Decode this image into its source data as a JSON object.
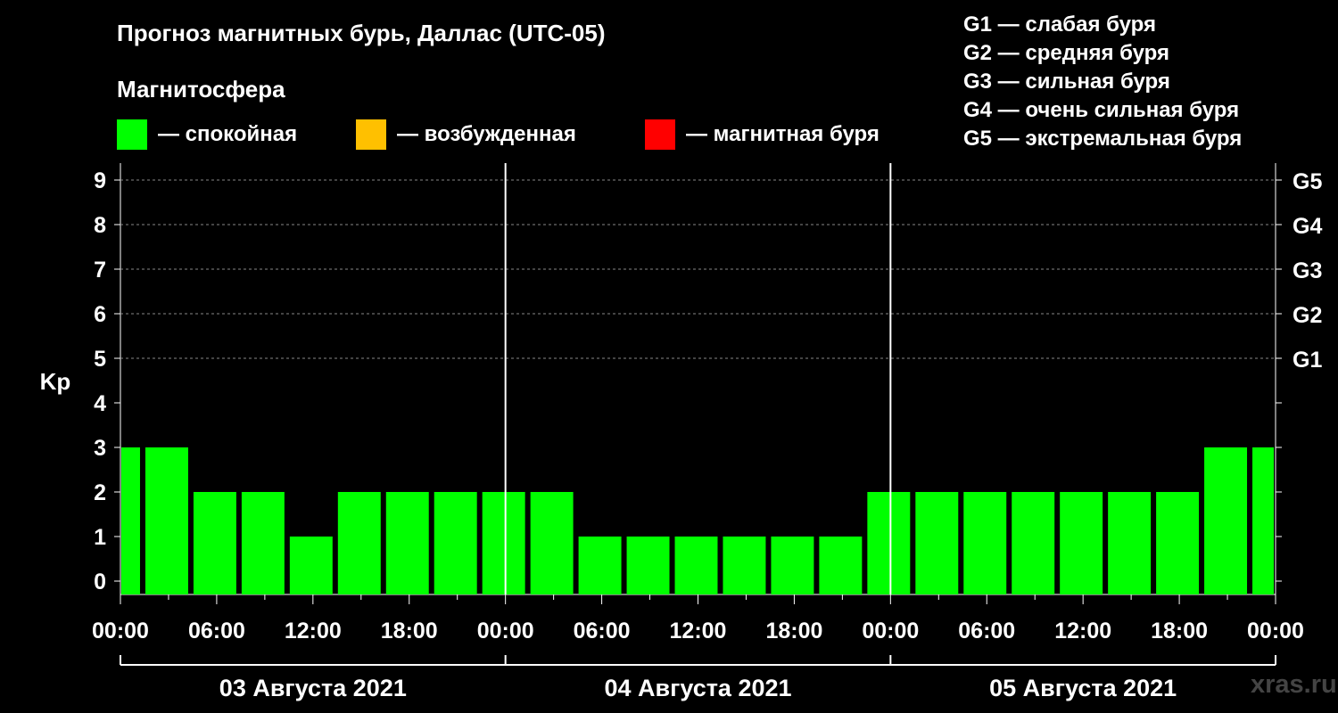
{
  "header": {
    "title": "Прогноз магнитных бурь, Даллас (UTC-05)",
    "magnetosphere_label": "Магнитосфера"
  },
  "legend": [
    {
      "label": "— спокойная",
      "color": "#00ff00"
    },
    {
      "label": "— возбужденная",
      "color": "#ffc000"
    },
    {
      "label": "— магнитная буря",
      "color": "#ff0000"
    }
  ],
  "g_legend": [
    "G1 — слабая буря",
    "G2 — средняя буря",
    "G3 — сильная буря",
    "G4 — очень сильная буря",
    "G5 — экстремальная буря"
  ],
  "watermark": "xras.ru",
  "chart_data": {
    "type": "bar",
    "ylabel": "Kp",
    "ylim": [
      0,
      9
    ],
    "y_ticks": [
      "0",
      "1",
      "2",
      "3",
      "4",
      "5",
      "6",
      "7",
      "8",
      "9"
    ],
    "right_ticks": [
      {
        "kp": 5,
        "label": "G1"
      },
      {
        "kp": 6,
        "label": "G2"
      },
      {
        "kp": 7,
        "label": "G3"
      },
      {
        "kp": 8,
        "label": "G4"
      },
      {
        "kp": 9,
        "label": "G5"
      }
    ],
    "x_tick_labels": [
      "00:00",
      "06:00",
      "12:00",
      "18:00",
      "00:00",
      "06:00",
      "12:00",
      "18:00",
      "00:00",
      "06:00",
      "12:00",
      "18:00",
      "00:00"
    ],
    "days": [
      "03 Августа 2021",
      "04 Августа 2021",
      "05 Августа 2021"
    ],
    "interval_hours": 3,
    "grid": "dashed horizontal at Kp 5–9",
    "values": [
      3,
      3,
      2,
      2,
      1,
      2,
      2,
      2,
      2,
      2,
      1,
      1,
      1,
      1,
      1,
      1,
      2,
      2,
      2,
      2,
      2,
      2,
      2,
      3,
      3
    ],
    "bar_color": "#00ff00"
  }
}
